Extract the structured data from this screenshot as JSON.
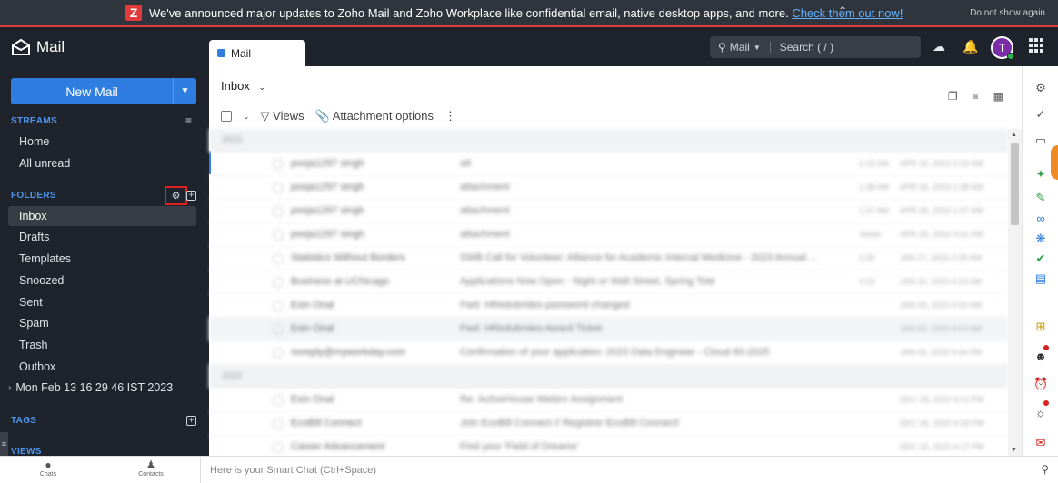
{
  "banner": {
    "logo_letter": "Z",
    "message": "We've announced major updates to Zoho Mail and Zoho Workplace like confidential email, native desktop apps, and more.",
    "link": "Check them out now!",
    "dismiss": "Do not show again"
  },
  "app": {
    "name": "Mail"
  },
  "sidebar": {
    "new_mail": "New Mail",
    "streams_label": "STREAMS",
    "streams": [
      {
        "label": "Home"
      },
      {
        "label": "All unread"
      }
    ],
    "folders_label": "FOLDERS",
    "folders": [
      {
        "label": "Inbox",
        "active": true
      },
      {
        "label": "Drafts"
      },
      {
        "label": "Templates"
      },
      {
        "label": "Snoozed"
      },
      {
        "label": "Sent"
      },
      {
        "label": "Spam"
      },
      {
        "label": "Trash"
      },
      {
        "label": "Outbox"
      },
      {
        "label": "Mon Feb 13 16 29 46 IST 2023"
      }
    ],
    "tags_label": "TAGS",
    "views_label": "VIEWS"
  },
  "topbar": {
    "tab_label": "Mail",
    "search_scope": "Mail",
    "search_placeholder": "Search ( / )",
    "avatar_initial": "T"
  },
  "main": {
    "folder_title": "Inbox",
    "toolbar": {
      "views": "Views",
      "attachment_options": "Attachment options"
    },
    "rows": [
      {
        "type": "group",
        "label": "2023"
      },
      {
        "from": "pooja1297 singh",
        "subject": "att",
        "time": "2:19 AM",
        "date": "APR 26, 2023 2:19 AM"
      },
      {
        "from": "pooja1297 singh",
        "subject": "attachment",
        "time": "1:38 AM",
        "date": "APR 26, 2023 1:38 AM"
      },
      {
        "from": "pooja1297 singh",
        "subject": "attachment",
        "time": "1:37 AM",
        "date": "APR 26, 2023 1:37 AM"
      },
      {
        "from": "pooja1297 singh",
        "subject": "attachment",
        "time": "Yester",
        "date": "APR 25, 2023 4:51 PM"
      },
      {
        "from": "Statistics Without Borders",
        "subject": "SWB Call for Volunteer: Alliance for Academic Internal Medicine - 2023 Annual ...",
        "time": "2:35",
        "date": "JAN 17, 2023 2:35 AM"
      },
      {
        "from": "Business at UChicago",
        "subject": "Applications Now Open - Night or Wall Street, Spring Tote",
        "time": "4:23",
        "date": "JAN 10, 2023 4:23 AM"
      },
      {
        "from": "Esin Onal",
        "subject": "Fwd: HRedubrides password changed",
        "time": "",
        "date": "JAN 03, 2023 4:03 AM"
      },
      {
        "from": "Esin Onal",
        "subject": "Fwd: HRedubrides Award Ticket",
        "time": "",
        "date": "JAN 03, 2023 4:03 AM",
        "selected": true
      },
      {
        "from": "noreply@myworkday.com",
        "subject": "Confirmation of your application: 2023 Data Engineer - Cloud 60-2025",
        "time": "",
        "date": "JAN 02, 2023 3:44 PM"
      },
      {
        "type": "group",
        "label": "2022"
      },
      {
        "from": "Esin Onal",
        "subject": "Re: ActiveHouse Webinr Assignment",
        "time": "",
        "date": "DEC 28, 2022 9:12 PM"
      },
      {
        "from": "EcoBill Connect",
        "subject": "Join EcoBill Connect // Registrer EcoBill Connect!",
        "time": "",
        "date": "DEC 26, 2022 4:18 PM"
      },
      {
        "from": "Career Advancement",
        "subject": "Find your 'Field of Dreams'",
        "time": "",
        "date": "DEC 22, 2022 4:17 PM"
      }
    ]
  },
  "bottombar": {
    "chats": "Chats",
    "contacts": "Contacts",
    "smart_chat_placeholder": "Here is your Smart Chat (Ctrl+Space)"
  },
  "colors": {
    "accent": "#2f7de1",
    "sidebar_bg": "#1f232b",
    "banner_border": "#e23b3b",
    "avatar": "#7a2ea6"
  }
}
